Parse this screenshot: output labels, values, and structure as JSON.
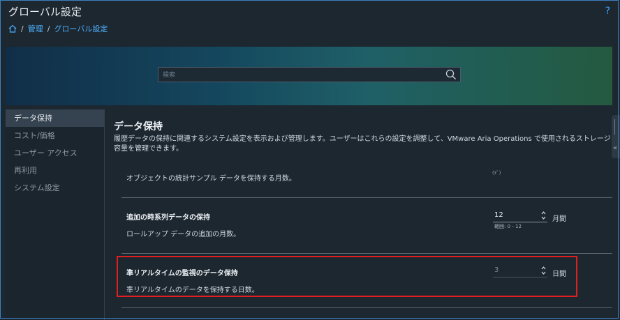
{
  "header": {
    "title": "グローバル設定",
    "help": "?",
    "breadcrumb": [
      "管理",
      "グローバル設定"
    ]
  },
  "search": {
    "placeholder": "検索"
  },
  "sidebar": {
    "items": [
      {
        "label": "データ保持",
        "active": true
      },
      {
        "label": "コスト/価格"
      },
      {
        "label": "ユーザー アクセス"
      },
      {
        "label": "再利用"
      },
      {
        "label": "システム設定"
      }
    ]
  },
  "main": {
    "title": "データ保持",
    "description": "履歴データの保持に関連するシステム設定を表示および管理します。ユーザーはこれらの設定を調整して、VMware Aria Operations で使用されるストレージ容量を管理できます。",
    "rows": [
      {
        "desc": "オブジェクトの統計サンプル データを保持する月数。"
      },
      {
        "title": "追加の時系列データの保持",
        "desc": "ロールアップ データの追加の月数。",
        "value": "12",
        "unit": "月間",
        "range": "範囲: 0 - 12"
      },
      {
        "title": "準リアルタイムの監視のデータ保持",
        "desc": "準リアルタイムのデータを保持する日数。",
        "value": "3",
        "unit": "日間"
      }
    ],
    "partial_text": "(ﾃﾞ)"
  },
  "side_handle": {
    "chevron": "«"
  },
  "colors": {
    "accent": "#4fb0ff",
    "highlight": "#e02020"
  }
}
